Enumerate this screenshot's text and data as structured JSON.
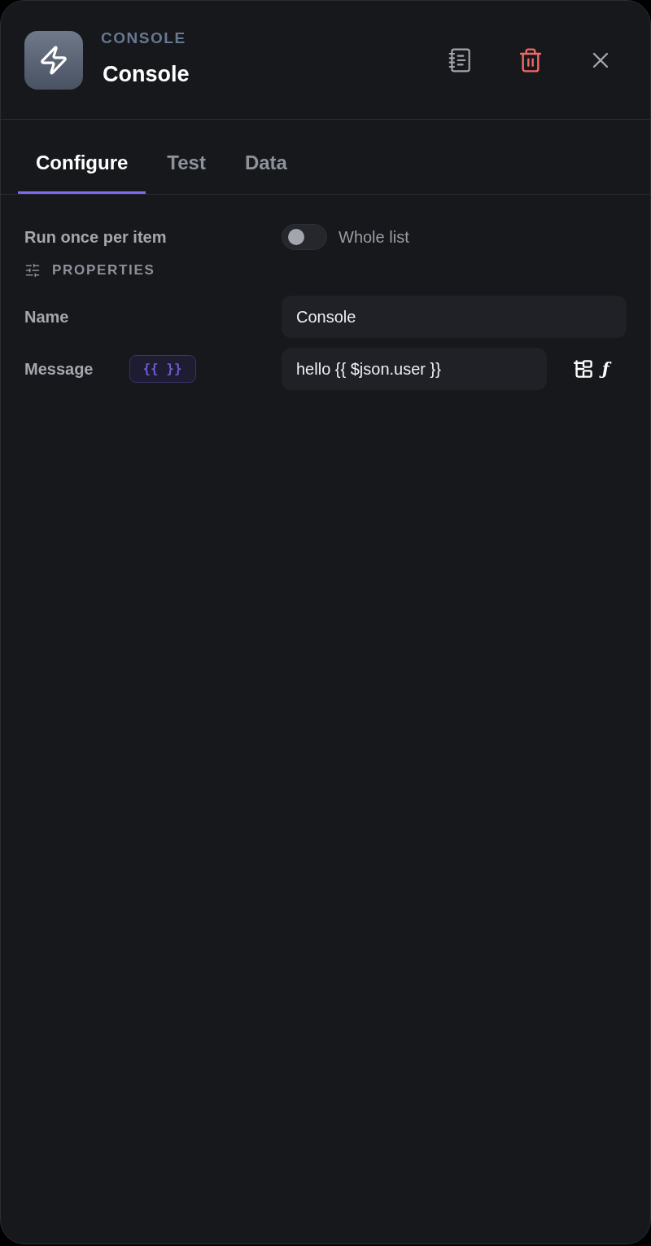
{
  "header": {
    "category": "CONSOLE",
    "title": "Console"
  },
  "tabs": [
    {
      "label": "Configure",
      "selected": true
    },
    {
      "label": "Test",
      "selected": false
    },
    {
      "label": "Data",
      "selected": false
    }
  ],
  "mode": {
    "label": "Run once per item",
    "on": false,
    "alt_label": "Whole list"
  },
  "section": {
    "label": "PROPERTIES"
  },
  "fields": [
    {
      "kind": "text",
      "label": "Name",
      "value": "Console"
    },
    {
      "kind": "expression",
      "label": "Message",
      "badge": "{{ }}",
      "value": "hello {{ $json.user }}",
      "function_symbol": "ƒ"
    }
  ]
}
